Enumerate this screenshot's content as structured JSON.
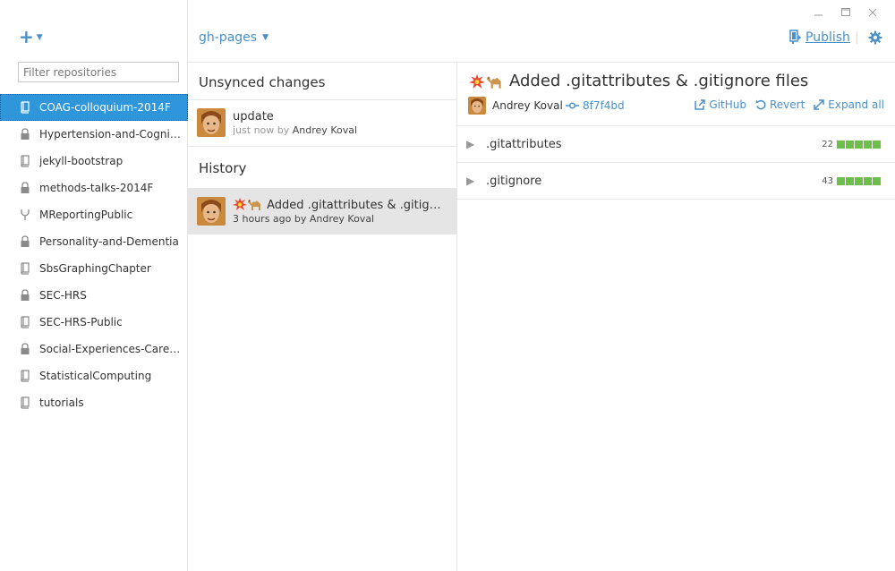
{
  "sidebar": {
    "filter_placeholder": "Filter repositories",
    "repos": [
      {
        "label": "COAG-colloquium-2014F",
        "icon": "book-icon",
        "selected": true
      },
      {
        "label": "Hypertension-and-Cognition",
        "icon": "lock-icon"
      },
      {
        "label": "jekyll-bootstrap",
        "icon": "book-icon"
      },
      {
        "label": "methods-talks-2014F",
        "icon": "lock-icon"
      },
      {
        "label": "MReportingPublic",
        "icon": "fork-icon"
      },
      {
        "label": "Personality-and-Dementia",
        "icon": "lock-icon"
      },
      {
        "label": "SbsGraphingChapter",
        "icon": "book-icon"
      },
      {
        "label": "SEC-HRS",
        "icon": "lock-icon"
      },
      {
        "label": "SEC-HRS-Public",
        "icon": "book-icon"
      },
      {
        "label": "Social-Experiences-Caregive...",
        "icon": "lock-icon"
      },
      {
        "label": "StatisticalComputing",
        "icon": "book-icon"
      },
      {
        "label": "tutorials",
        "icon": "book-icon"
      }
    ]
  },
  "toolbar": {
    "branch": "gh-pages",
    "publish": "Publish"
  },
  "changes": {
    "unsynced_title": "Unsynced changes",
    "history_title": "History",
    "unsynced": {
      "message": "update",
      "time": "just now",
      "by": "by",
      "author": "Andrey Koval"
    },
    "history": [
      {
        "message": "Added .gitattributes & .gitign...",
        "time": "3 hours ago",
        "by": "by",
        "author": "Andrey Koval"
      }
    ]
  },
  "detail": {
    "title": "Added .gitattributes & .gitignore files",
    "author": "Andrey Koval",
    "sha": "8f7f4bd",
    "actions": {
      "github": "GitHub",
      "revert": "Revert",
      "expand": "Expand all"
    },
    "files": [
      {
        "name": ".gitattributes",
        "count": "22"
      },
      {
        "name": ".gitignore",
        "count": "43"
      }
    ]
  },
  "colors": {
    "accent": "#4a90c8",
    "selected": "#2f96dc",
    "additions": "#6cc04a"
  }
}
